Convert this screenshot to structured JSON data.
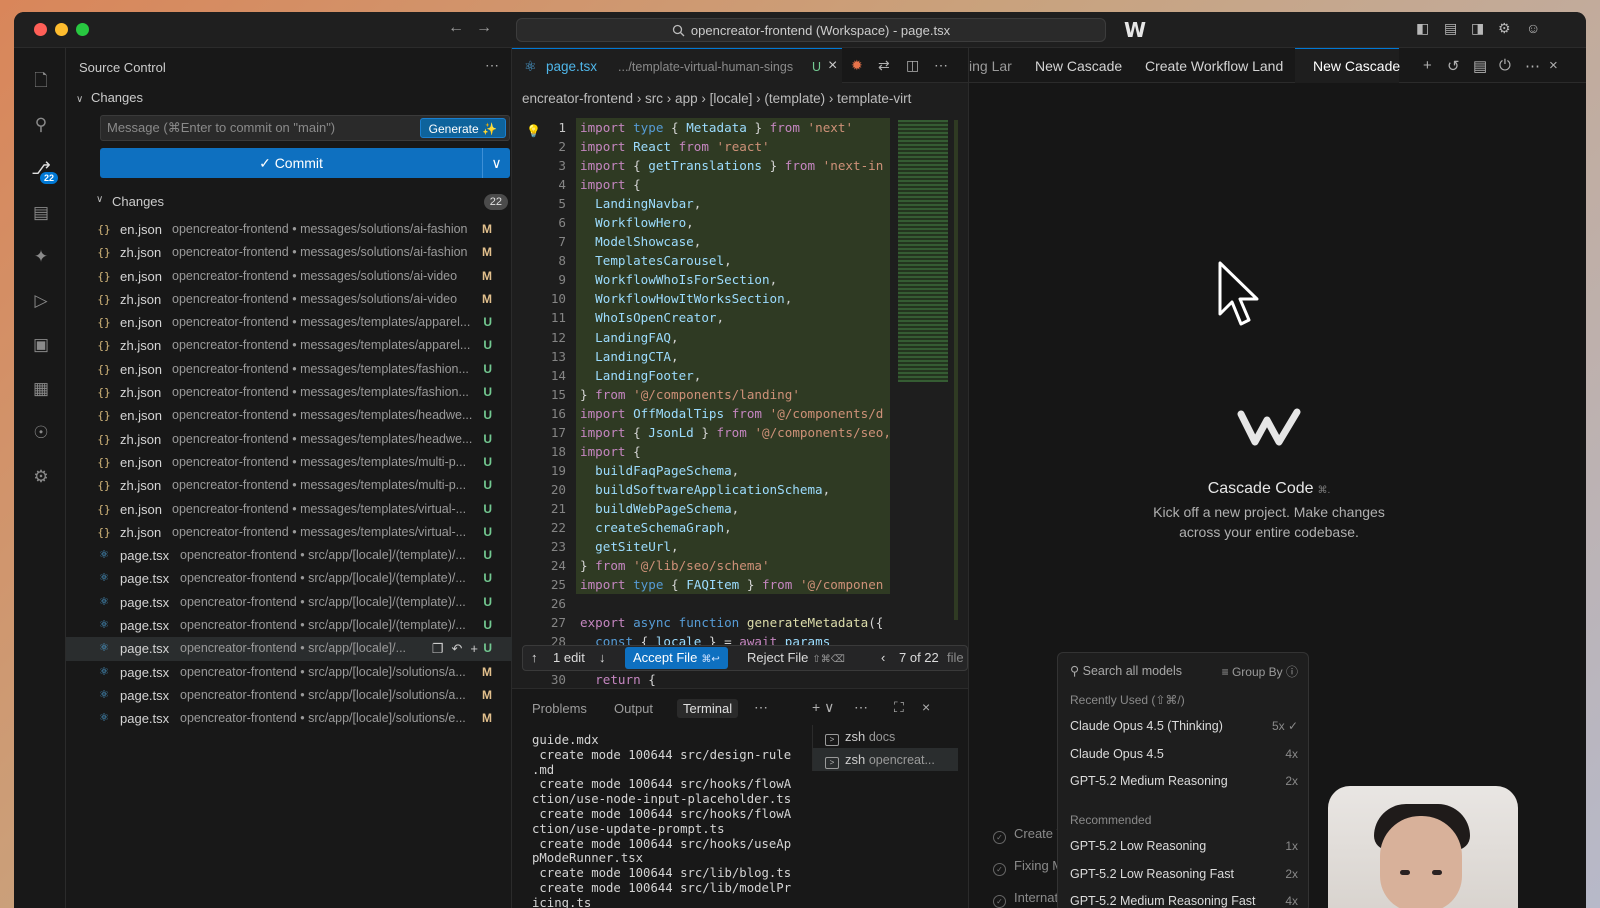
{
  "titlebar": {
    "command_center": "opencreator-frontend (Workspace) - page.tsx"
  },
  "activity": {
    "scm_badge": "22"
  },
  "sidebar": {
    "title": "Source Control",
    "section_label": "Changes",
    "message_placeholder": "Message (⌘Enter to commit on \"main\")",
    "generate_label": "Generate",
    "commit_label": "Commit",
    "changes_label": "Changes",
    "changes_count": "22",
    "files": [
      {
        "name": "en.json",
        "path": "opencreator-frontend • messages/solutions/ai-fashion",
        "status": "M",
        "kind": "json"
      },
      {
        "name": "zh.json",
        "path": "opencreator-frontend • messages/solutions/ai-fashion",
        "status": "M",
        "kind": "json"
      },
      {
        "name": "en.json",
        "path": "opencreator-frontend • messages/solutions/ai-video",
        "status": "M",
        "kind": "json"
      },
      {
        "name": "zh.json",
        "path": "opencreator-frontend • messages/solutions/ai-video",
        "status": "M",
        "kind": "json"
      },
      {
        "name": "en.json",
        "path": "opencreator-frontend • messages/templates/apparel...",
        "status": "U",
        "kind": "json"
      },
      {
        "name": "zh.json",
        "path": "opencreator-frontend • messages/templates/apparel...",
        "status": "U",
        "kind": "json"
      },
      {
        "name": "en.json",
        "path": "opencreator-frontend • messages/templates/fashion...",
        "status": "U",
        "kind": "json"
      },
      {
        "name": "zh.json",
        "path": "opencreator-frontend • messages/templates/fashion...",
        "status": "U",
        "kind": "json"
      },
      {
        "name": "en.json",
        "path": "opencreator-frontend • messages/templates/headwe...",
        "status": "U",
        "kind": "json"
      },
      {
        "name": "zh.json",
        "path": "opencreator-frontend • messages/templates/headwe...",
        "status": "U",
        "kind": "json"
      },
      {
        "name": "en.json",
        "path": "opencreator-frontend • messages/templates/multi-p...",
        "status": "U",
        "kind": "json"
      },
      {
        "name": "zh.json",
        "path": "opencreator-frontend • messages/templates/multi-p...",
        "status": "U",
        "kind": "json"
      },
      {
        "name": "en.json",
        "path": "opencreator-frontend • messages/templates/virtual-...",
        "status": "U",
        "kind": "json"
      },
      {
        "name": "zh.json",
        "path": "opencreator-frontend • messages/templates/virtual-...",
        "status": "U",
        "kind": "json"
      },
      {
        "name": "page.tsx",
        "path": "opencreator-frontend • src/app/[locale]/(template)/...",
        "status": "U",
        "kind": "tsx"
      },
      {
        "name": "page.tsx",
        "path": "opencreator-frontend • src/app/[locale]/(template)/...",
        "status": "U",
        "kind": "tsx"
      },
      {
        "name": "page.tsx",
        "path": "opencreator-frontend • src/app/[locale]/(template)/...",
        "status": "U",
        "kind": "tsx"
      },
      {
        "name": "page.tsx",
        "path": "opencreator-frontend • src/app/[locale]/(template)/...",
        "status": "U",
        "kind": "tsx"
      },
      {
        "name": "page.tsx",
        "path": "opencreator-frontend • src/app/[locale]/...",
        "status": "U",
        "kind": "tsx",
        "selected": true
      },
      {
        "name": "page.tsx",
        "path": "opencreator-frontend • src/app/[locale]/solutions/a...",
        "status": "M",
        "kind": "tsx"
      },
      {
        "name": "page.tsx",
        "path": "opencreator-frontend • src/app/[locale]/solutions/a...",
        "status": "M",
        "kind": "tsx"
      },
      {
        "name": "page.tsx",
        "path": "opencreator-frontend • src/app/[locale]/solutions/e...",
        "status": "M",
        "kind": "tsx"
      }
    ]
  },
  "editor": {
    "tab_name": "page.tsx",
    "tab_path": ".../template-virtual-human-sings",
    "tab_status": "U",
    "breadcrumb": "encreator-frontend  ›  src  ›  app  ›  [locale]  ›  (template)  ›  template-virt",
    "lines": [
      {
        "n": "1",
        "html": "<span class='kw2'>import</span> <span class='kw'>type</span> { <span class='id'>Metadata</span> } <span class='kw2'>from</span> <span class='str'>'next'</span>"
      },
      {
        "n": "2",
        "html": "<span class='kw2'>import</span> <span class='id'>React</span> <span class='kw2'>from</span> <span class='str'>'react'</span>"
      },
      {
        "n": "3",
        "html": "<span class='kw2'>import</span> { <span class='id'>getTranslations</span> } <span class='kw2'>from</span> <span class='str'>'next-in</span>"
      },
      {
        "n": "4",
        "html": "<span class='kw2'>import</span> {"
      },
      {
        "n": "5",
        "html": "  <span class='id'>LandingNavbar</span>,"
      },
      {
        "n": "6",
        "html": "  <span class='id'>WorkflowHero</span>,"
      },
      {
        "n": "7",
        "html": "  <span class='id'>ModelShowcase</span>,"
      },
      {
        "n": "8",
        "html": "  <span class='id'>TemplatesCarousel</span>,"
      },
      {
        "n": "9",
        "html": "  <span class='id'>WorkflowWhoIsForSection</span>,"
      },
      {
        "n": "10",
        "html": "  <span class='id'>WorkflowHowItWorksSection</span>,"
      },
      {
        "n": "11",
        "html": "  <span class='id'>WhoIsOpenCreator</span>,"
      },
      {
        "n": "12",
        "html": "  <span class='id'>LandingFAQ</span>,"
      },
      {
        "n": "13",
        "html": "  <span class='id'>LandingCTA</span>,"
      },
      {
        "n": "14",
        "html": "  <span class='id'>LandingFooter</span>,"
      },
      {
        "n": "15",
        "html": "} <span class='kw2'>from</span> <span class='str'>'@/components/landing'</span>"
      },
      {
        "n": "16",
        "html": "<span class='kw2'>import</span> <span class='id'>OffModalTips</span> <span class='kw2'>from</span> <span class='str'>'@/components/d</span>"
      },
      {
        "n": "17",
        "html": "<span class='kw2'>import</span> { <span class='id'>JsonLd</span> } <span class='kw2'>from</span> <span class='str'>'@/components/seo,</span>"
      },
      {
        "n": "18",
        "html": "<span class='kw2'>import</span> {"
      },
      {
        "n": "19",
        "html": "  <span class='id'>buildFaqPageSchema</span>,"
      },
      {
        "n": "20",
        "html": "  <span class='id'>buildSoftwareApplicationSchema</span>,"
      },
      {
        "n": "21",
        "html": "  <span class='id'>buildWebPageSchema</span>,"
      },
      {
        "n": "22",
        "html": "  <span class='id'>createSchemaGraph</span>,"
      },
      {
        "n": "23",
        "html": "  <span class='id'>getSiteUrl</span>,"
      },
      {
        "n": "24",
        "html": "} <span class='kw2'>from</span> <span class='str'>'@/lib/seo/schema'</span>"
      },
      {
        "n": "25",
        "html": "<span class='kw2'>import</span> <span class='kw'>type</span> { <span class='id'>FAQItem</span> } <span class='kw2'>from</span> <span class='str'>'@/componen</span>"
      },
      {
        "n": "26",
        "html": ""
      },
      {
        "n": "27",
        "html": "<span class='kw2'>export</span> <span class='kw'>async</span> <span class='kw'>function</span> <span class='fn'>generateMetadata</span>({"
      },
      {
        "n": "28",
        "html": "  <span class='kw'>const</span> { <span class='id'>locale</span> } = <span class='kw2'>await</span> <span class='id'>params</span>"
      },
      {
        "n": "29",
        "html": ""
      },
      {
        "n": "30",
        "html": "  <span class='kw2'>return</span> {"
      }
    ],
    "edit_count": "1 edit",
    "accept_label": "Accept File",
    "accept_kbd": "⌘↩",
    "reject_label": "Reject File",
    "reject_kbd": "⇧⌘⌫",
    "file_counter": "7 of 22",
    "file_word": "file"
  },
  "panel": {
    "tabs": [
      "Problems",
      "Output",
      "Terminal"
    ],
    "terminal_output": "guide.mdx\n create mode 100644 src/design-rule\n.md\n create mode 100644 src/hooks/flowA\nction/use-node-input-placeholder.ts\n create mode 100644 src/hooks/flowA\nction/use-update-prompt.ts\n create mode 100644 src/hooks/useAp\npModeRunner.tsx\n create mode 100644 src/lib/blog.ts\n create mode 100644 src/lib/modelPr\nicing.ts",
    "terminals": [
      {
        "name": "zsh",
        "sub": "docs"
      },
      {
        "name": "zsh",
        "sub": "opencreat..."
      }
    ]
  },
  "cascade": {
    "tabs": [
      "ing Lar",
      "New Cascade",
      "Create Workflow Land",
      "New Cascade"
    ],
    "title": "Cascade Code",
    "title_hint": "⌘.",
    "subtitle": "Kick off a new project. Make changes across your entire codebase.",
    "search_placeholder": "Search all models",
    "group_by": "Group By",
    "recent_header": "Recently Used (⇧⌘/)",
    "recommended_header": "Recommended",
    "recent": [
      {
        "name": "Claude Opus 4.5 (Thinking)",
        "mult": "5x ✓"
      },
      {
        "name": "Claude Opus 4.5",
        "mult": "4x"
      },
      {
        "name": "GPT-5.2 Medium Reasoning",
        "mult": "2x"
      }
    ],
    "recommended": [
      {
        "name": "GPT-5.2 Low Reasoning",
        "mult": "1x"
      },
      {
        "name": "GPT-5.2 Low Reasoning Fast",
        "mult": "2x"
      },
      {
        "name": "GPT-5.2 Medium Reasoning Fast",
        "mult": "4x"
      }
    ],
    "background_items": [
      "Create V",
      "Fixing M",
      "Internat"
    ]
  }
}
